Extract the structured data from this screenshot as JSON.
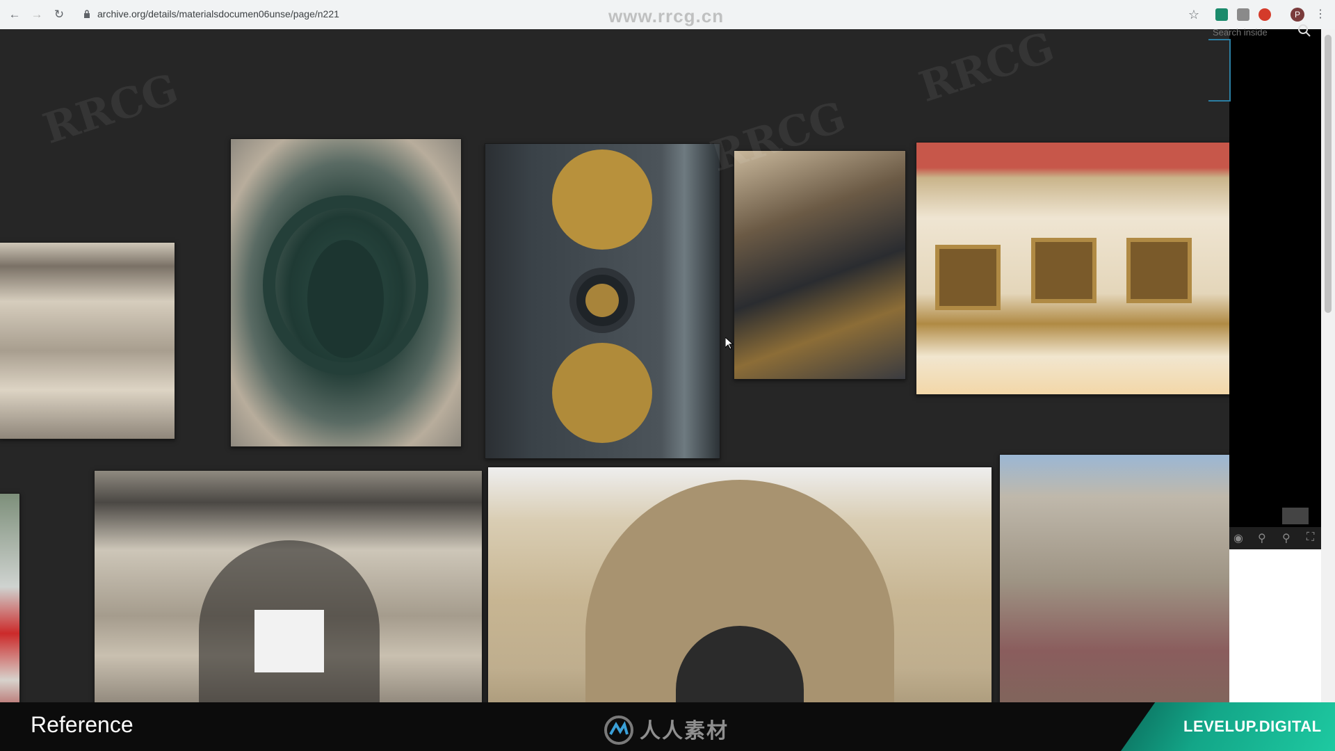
{
  "browser": {
    "url": "archive.org/details/materialsdocumen06unse/page/n221",
    "overlay_brand": "www.rrcg.cn",
    "profile_initial": "P"
  },
  "viewer": {
    "search_placeholder": "Search inside"
  },
  "footer": {
    "title": "Reference",
    "logo_text": "人人素材",
    "brand": "LEVELUP.DIGITAL"
  },
  "colors": {
    "accent": "#1ec9a1",
    "background": "#262626"
  },
  "photos": [
    {
      "name": "photo-cornice"
    },
    {
      "name": "photo-green-ironwork"
    },
    {
      "name": "photo-gold-flower-gate"
    },
    {
      "name": "photo-gold-scroll-railing"
    },
    {
      "name": "photo-coffered-arch"
    },
    {
      "name": "photo-partial-red"
    },
    {
      "name": "photo-balcony-facade"
    },
    {
      "name": "photo-grand-arch"
    },
    {
      "name": "photo-statue-facade"
    }
  ]
}
